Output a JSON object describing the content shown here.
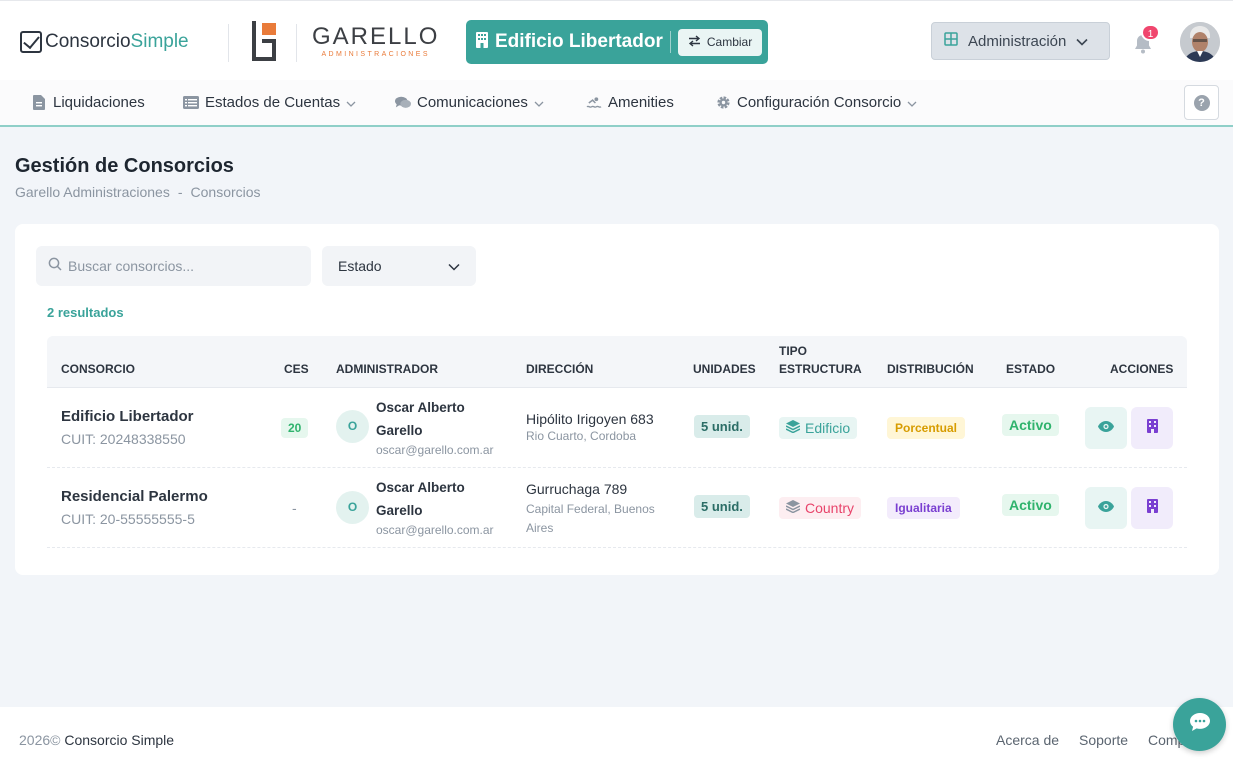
{
  "header": {
    "brand_part1": "Consorcio",
    "brand_part2": "Simple",
    "company_name": "GARELLO",
    "company_tagline": "ADMINISTRACIONES",
    "building_name": "Edificio Libertador",
    "change_label": "Cambiar",
    "role_selector": "Administración",
    "notification_count": "1"
  },
  "nav": {
    "items": [
      {
        "label": "Liquidaciones"
      },
      {
        "label": "Estados de Cuentas"
      },
      {
        "label": "Comunicaciones"
      },
      {
        "label": "Amenities"
      },
      {
        "label": "Configuración Consorcio"
      }
    ],
    "help_label": "?"
  },
  "page": {
    "title": "Gestión de Consorcios",
    "breadcrumb": [
      "Garello Administraciones",
      "Consorcios"
    ],
    "breadcrumb_sep": "-"
  },
  "filters": {
    "search_placeholder": "Buscar consorcios...",
    "estado_label": "Estado"
  },
  "results_label": "2 resultados",
  "table": {
    "headers": {
      "consorcio": "CONSORCIO",
      "ces": "CES",
      "administrador": "ADMINISTRADOR",
      "direccion": "DIRECCIÓN",
      "unidades": "UNIDADES",
      "tipo_line1": "TIPO",
      "tipo_line2": "ESTRUCTURA",
      "distribucion": "DISTRIBUCIÓN",
      "estado": "ESTADO",
      "acciones": "ACCIONES"
    },
    "rows": [
      {
        "name": "Edificio Libertador",
        "cuit": "CUIT: 20248338550",
        "ces": "20",
        "admin_initial": "O",
        "admin_name_line1": "Oscar Alberto",
        "admin_name_line2": "Garello",
        "admin_email": "oscar@garello.com.ar",
        "address": "Hipólito Irigoyen 683",
        "city_line1": "Rio Cuarto, Cordoba",
        "city_line2": "",
        "units": "5 unid.",
        "structure": "Edificio",
        "distribution": "Porcentual",
        "status": "Activo"
      },
      {
        "name": "Residencial Palermo",
        "cuit": "CUIT: 20-55555555-5",
        "ces": "-",
        "admin_initial": "O",
        "admin_name_line1": "Oscar Alberto",
        "admin_name_line2": "Garello",
        "admin_email": "oscar@garello.com.ar",
        "address": "Gurruchaga 789",
        "city_line1": "Capital Federal, Buenos",
        "city_line2": "Aires",
        "units": "5 unid.",
        "structure": "Country",
        "distribution": "Igualitaria",
        "status": "Activo"
      }
    ]
  },
  "footer": {
    "year": "2026©",
    "brand": "Consorcio Simple",
    "links": [
      "Acerca de",
      "Soporte",
      "Comp"
    ]
  },
  "colors": {
    "accent": "#3aa39a",
    "brand_orange": "#e97b3a",
    "notification": "#f0466e",
    "success": "#2fb36d",
    "country": "#e8446b",
    "igualitaria": "#7a3fd1",
    "porcentual": "#d79c00"
  },
  "icons": [
    "check-square-icon",
    "building-icon",
    "swap-icon",
    "grid-icon",
    "chevron-down-icon",
    "bell-icon",
    "file-invoice-icon",
    "list-icon",
    "comments-icon",
    "swimmer-icon",
    "gear-icon",
    "question-icon",
    "search-icon",
    "layers-icon",
    "eye-icon",
    "chat-icon"
  ]
}
